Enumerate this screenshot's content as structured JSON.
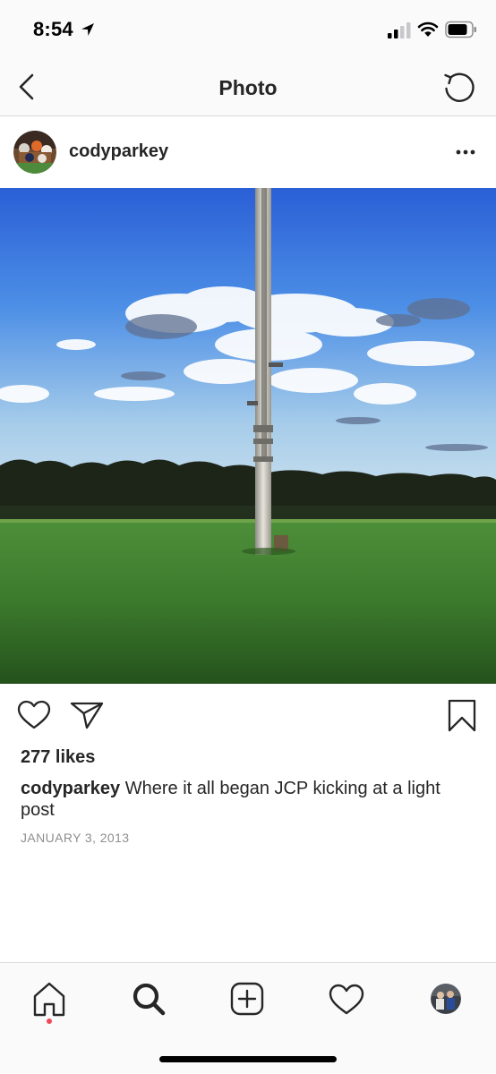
{
  "status_bar": {
    "time": "8:54",
    "icons": [
      "location-arrow-icon",
      "cellular-signal-icon",
      "wifi-icon",
      "battery-icon"
    ]
  },
  "nav": {
    "title": "Photo",
    "back_icon": "chevron-left-icon",
    "refresh_icon": "refresh-icon"
  },
  "post": {
    "username": "codyparkey",
    "more_icon": "more-horizontal-icon",
    "likes": "277 likes",
    "caption_user": "codyparkey",
    "caption_text": "Where it all began JCP kicking at a light post",
    "date": "JANUARY 3, 2013",
    "action_icons": [
      "heart-icon",
      "paper-plane-icon",
      "bookmark-icon"
    ]
  },
  "tab_bar": {
    "items": [
      "home-icon",
      "search-icon",
      "plus-square-icon",
      "heart-icon",
      "profile-avatar"
    ],
    "active": "home-icon"
  },
  "colors": {
    "text": "#262626",
    "secondary_text": "#8e8e8e",
    "divider": "#dbdbdb",
    "bar_background": "#fafafa",
    "notification_dot": "#ed4956"
  }
}
